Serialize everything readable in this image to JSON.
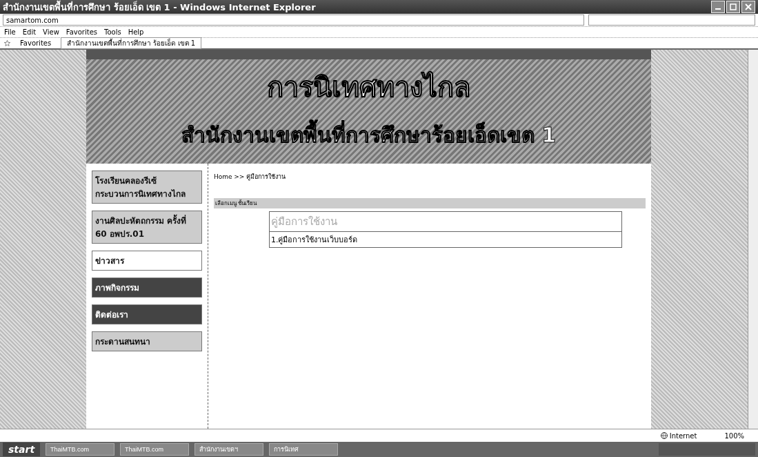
{
  "window": {
    "title": "สำนักงานเขตพื้นที่การศึกษา ร้อยเอ็ด เขต 1 - Windows Internet Explorer"
  },
  "address_bar": {
    "value": "samartom.com"
  },
  "menu": [
    "File",
    "Edit",
    "View",
    "Favorites",
    "Tools",
    "Help"
  ],
  "favorites_bar": {
    "label": "Favorites",
    "tabs": [
      {
        "label": "สำนักงานเขตพื้นที่การศึกษา ร้อยเอ็ด เขต 1",
        "selected": true
      }
    ]
  },
  "banner": {
    "title": "การนิเทศทางไกล",
    "subtitle": "สำนักงานเขตพื้นที่การศึกษาร้อยเอ็ดเขต 1"
  },
  "sidebar": {
    "items": [
      {
        "kind": "badge",
        "label": "โรงเรียนคลองรีเซ้ กระบวนการนิเทศทางไกล"
      },
      {
        "kind": "badge",
        "label": "งานศิลปะหัตถกรรม ครั้งที่ 60 อพปร.01"
      },
      {
        "kind": "plain",
        "label": "ข่าวสาร"
      },
      {
        "kind": "dark",
        "label": "ภาพกิจกรรม"
      },
      {
        "kind": "dark",
        "label": "ติดต่อเรา"
      },
      {
        "kind": "badge",
        "label": "กระดานสนทนา"
      }
    ]
  },
  "breadcrumb": "Home >> คู่มือการใช้งาน",
  "section": {
    "header": "เลือกเมนู ชั้นเรียน",
    "box_title": "คู่มือการใช้งาน",
    "rows": [
      "1.คู่มือการใช้งานเว็บบอร์ด"
    ]
  },
  "status_bar": {
    "zone": "Internet",
    "zoom": "100%"
  },
  "taskbar": {
    "start": "start",
    "buttons": [
      "ThaiMTB.com",
      "ThaiMTB.com",
      "สำนักงานเขตฯ",
      "การนิเทศ"
    ]
  }
}
